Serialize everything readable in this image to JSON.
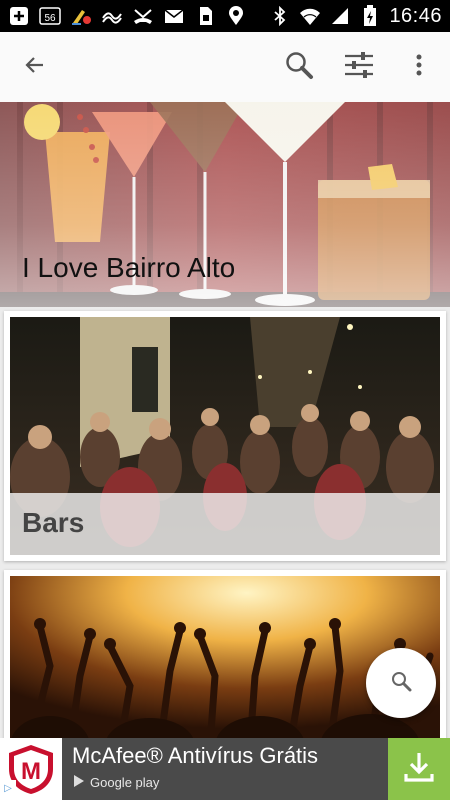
{
  "status_bar": {
    "time": "16:46",
    "icons": [
      "add-icon",
      "signal-56-icon",
      "cleaner-icon",
      "wave-icon",
      "missed-call-icon",
      "mail-icon",
      "sim-icon",
      "location-icon",
      "bluetooth-icon",
      "wifi-icon",
      "cell-signal-icon",
      "battery-icon"
    ]
  },
  "app_bar": {
    "back_icon": "arrow-back-icon",
    "search_icon": "search-icon",
    "filter_icon": "tune-icon",
    "more_icon": "more-vert-icon"
  },
  "hero": {
    "title": "I Love Bairro Alto"
  },
  "cards": [
    {
      "title": "Bars"
    },
    {
      "title": ""
    }
  ],
  "fab": {
    "icon": "search-icon"
  },
  "ad": {
    "title": "McAfee® Antivírus Grátis",
    "store": "Google play",
    "logo_letter": "M",
    "badge": "▷",
    "download_icon": "download-icon"
  },
  "colors": {
    "ad_download": "#8bc34a",
    "ad_background": "#4a4a4a",
    "mcafee_red": "#c8102e"
  }
}
